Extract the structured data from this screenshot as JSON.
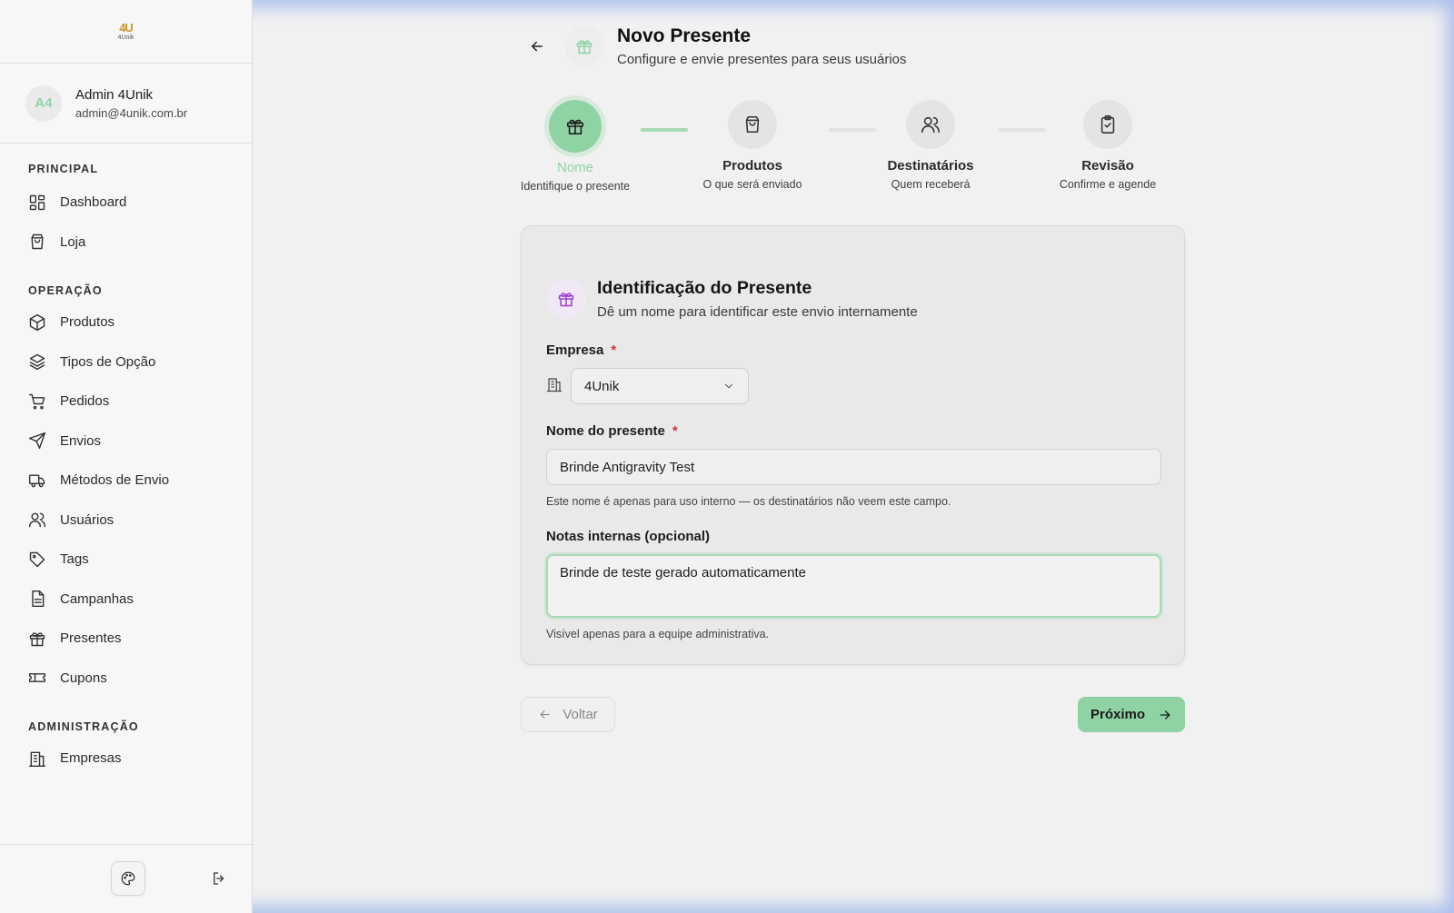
{
  "brand": {
    "logo_mark": "4U",
    "logo_text": "4Unik"
  },
  "user": {
    "initials": "A4",
    "name": "Admin 4Unik",
    "email": "admin@4unik.com.br"
  },
  "sidebar": {
    "sections": [
      {
        "heading": "PRINCIPAL",
        "items": [
          {
            "label": "Dashboard",
            "icon": "dashboard-icon"
          },
          {
            "label": "Loja",
            "icon": "shopping-bag-icon"
          }
        ]
      },
      {
        "heading": "OPERAÇÃO",
        "items": [
          {
            "label": "Produtos",
            "icon": "box-icon"
          },
          {
            "label": "Tipos de Opção",
            "icon": "layers-icon"
          },
          {
            "label": "Pedidos",
            "icon": "cart-icon"
          },
          {
            "label": "Envios",
            "icon": "send-icon"
          },
          {
            "label": "Métodos de Envio",
            "icon": "truck-icon"
          },
          {
            "label": "Usuários",
            "icon": "users-icon"
          },
          {
            "label": "Tags",
            "icon": "tag-icon"
          },
          {
            "label": "Campanhas",
            "icon": "document-icon"
          },
          {
            "label": "Presentes",
            "icon": "gift-icon"
          },
          {
            "label": "Cupons",
            "icon": "ticket-icon"
          }
        ]
      },
      {
        "heading": "ADMINISTRAÇÃO",
        "items": [
          {
            "label": "Empresas",
            "icon": "building-icon"
          }
        ]
      }
    ]
  },
  "header": {
    "title": "Novo Presente",
    "subtitle": "Configure e envie presentes para seus usuários"
  },
  "stepper": {
    "current_step": 1,
    "steps": [
      {
        "label": "Nome",
        "desc": "Identifique o presente",
        "icon": "gift-icon"
      },
      {
        "label": "Produtos",
        "desc": "O que será enviado",
        "icon": "shopping-bag-icon"
      },
      {
        "label": "Destinatários",
        "desc": "Quem receberá",
        "icon": "users-icon"
      },
      {
        "label": "Revisão",
        "desc": "Confirme e agende",
        "icon": "clipboard-icon"
      }
    ]
  },
  "card": {
    "title": "Identificação do Presente",
    "subtitle": "Dê um nome para identificar este envio internamente",
    "company": {
      "label": "Empresa",
      "required_mark": "*",
      "value": "4Unik"
    },
    "gift_name": {
      "label": "Nome do presente",
      "required_mark": "*",
      "value": "Brinde Antigravity Test",
      "hint": "Este nome é apenas para uso interno — os destinatários não veem este campo."
    },
    "notes": {
      "label": "Notas internas (opcional)",
      "value": "Brinde de teste gerado automaticamente",
      "hint": "Visível apenas para a equipe administrativa."
    }
  },
  "nav": {
    "back_label": "Voltar",
    "next_label": "Próximo"
  },
  "colors": {
    "accent": "#8fd3a4",
    "purple": "#9b3fd1",
    "required": "#d63333"
  }
}
